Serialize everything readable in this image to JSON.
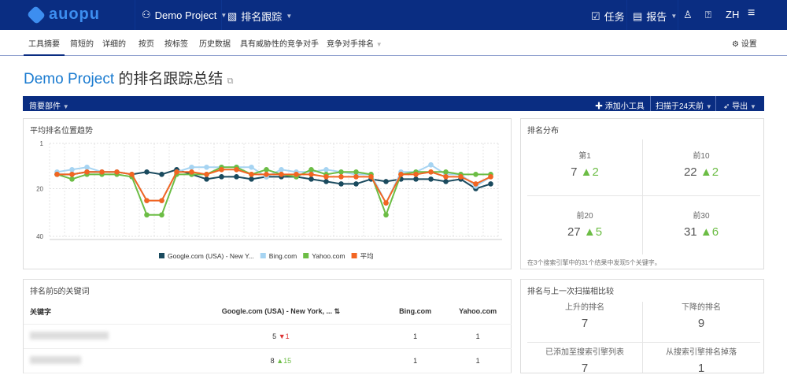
{
  "header": {
    "logo": "auopu",
    "project": "Demo Project",
    "tool": "排名跟踪",
    "tasks": "任务",
    "reports": "报告",
    "lang": "ZH"
  },
  "subnav": {
    "items": [
      "工具摘要",
      "简短的",
      "详细的",
      "按页",
      "按标签",
      "历史数据",
      "具有威胁性的竞争对手",
      "竞争对手排名"
    ],
    "settings": "设置"
  },
  "title": {
    "project": "Demo Project",
    "suffix": " 的排名跟踪总结"
  },
  "toolbar": {
    "summary": "简要部件",
    "add": "添加小工具",
    "scanned": "扫描于24天前",
    "export": "导出"
  },
  "chart_data": {
    "type": "line",
    "title": "平均排名位置趋势",
    "yticks": [
      "1",
      "20",
      "40"
    ],
    "ylim": [
      1,
      40
    ],
    "reversed": true,
    "series": [
      {
        "name": "Google.com (USA) - New Y...",
        "color": "#1a4a5e",
        "values": [
          14,
          14,
          13,
          13,
          13,
          14,
          13,
          14,
          12,
          14,
          16,
          15,
          15,
          16,
          15,
          15,
          15,
          16,
          17,
          18,
          18,
          16,
          17,
          16,
          16,
          16,
          17,
          16,
          20,
          18
        ]
      },
      {
        "name": "Bing.com",
        "color": "#a6d4f2",
        "values": [
          13,
          12,
          11,
          13,
          13,
          14,
          25,
          25,
          13,
          11,
          11,
          11,
          11,
          11,
          15,
          12,
          13,
          13,
          12,
          13,
          14,
          14,
          26,
          13,
          13,
          10,
          14,
          14,
          19,
          15
        ]
      },
      {
        "name": "Yahoo.com",
        "color": "#6cbd45",
        "values": [
          14,
          16,
          14,
          14,
          14,
          15,
          31,
          31,
          14,
          14,
          14,
          11,
          11,
          14,
          12,
          14,
          15,
          12,
          14,
          13,
          13,
          14,
          31,
          14,
          13,
          13,
          13,
          14,
          14,
          14
        ]
      },
      {
        "name": "平均",
        "color": "#f26522",
        "values": [
          14,
          14,
          13,
          13,
          13,
          14,
          25,
          25,
          13,
          13,
          14,
          12,
          12,
          14,
          14,
          14,
          14,
          14,
          15,
          15,
          15,
          15,
          26,
          14,
          14,
          13,
          15,
          15,
          18,
          15
        ]
      }
    ]
  },
  "distribution": {
    "title": "排名分布",
    "cells": [
      {
        "label": "第1",
        "value": "7",
        "delta": "2"
      },
      {
        "label": "前10",
        "value": "22",
        "delta": "2"
      },
      {
        "label": "前20",
        "value": "27",
        "delta": "5"
      },
      {
        "label": "前30",
        "value": "31",
        "delta": "6"
      }
    ],
    "note": "在3个搜索引擎中的31个结果中发现5个关键字。"
  },
  "top5": {
    "title": "排名前5的关键词",
    "headers": [
      "关键字",
      "Google.com (USA) - New York, ...",
      "Bing.com",
      "Yahoo.com"
    ],
    "rows": [
      {
        "google": "5",
        "change": "1",
        "dir": "down",
        "bing": "1",
        "yahoo": "1"
      },
      {
        "google": "8",
        "change": "15",
        "dir": "up",
        "bing": "1",
        "yahoo": "1"
      }
    ]
  },
  "compare": {
    "title": "排名与上一次扫描相比较",
    "cells": [
      {
        "label": "上升的排名",
        "value": "7"
      },
      {
        "label": "下降的排名",
        "value": "9"
      },
      {
        "label": "已添加至搜索引擎列表",
        "value": "7"
      },
      {
        "label": "从搜索引擎排名掉落",
        "value": "1"
      }
    ]
  }
}
